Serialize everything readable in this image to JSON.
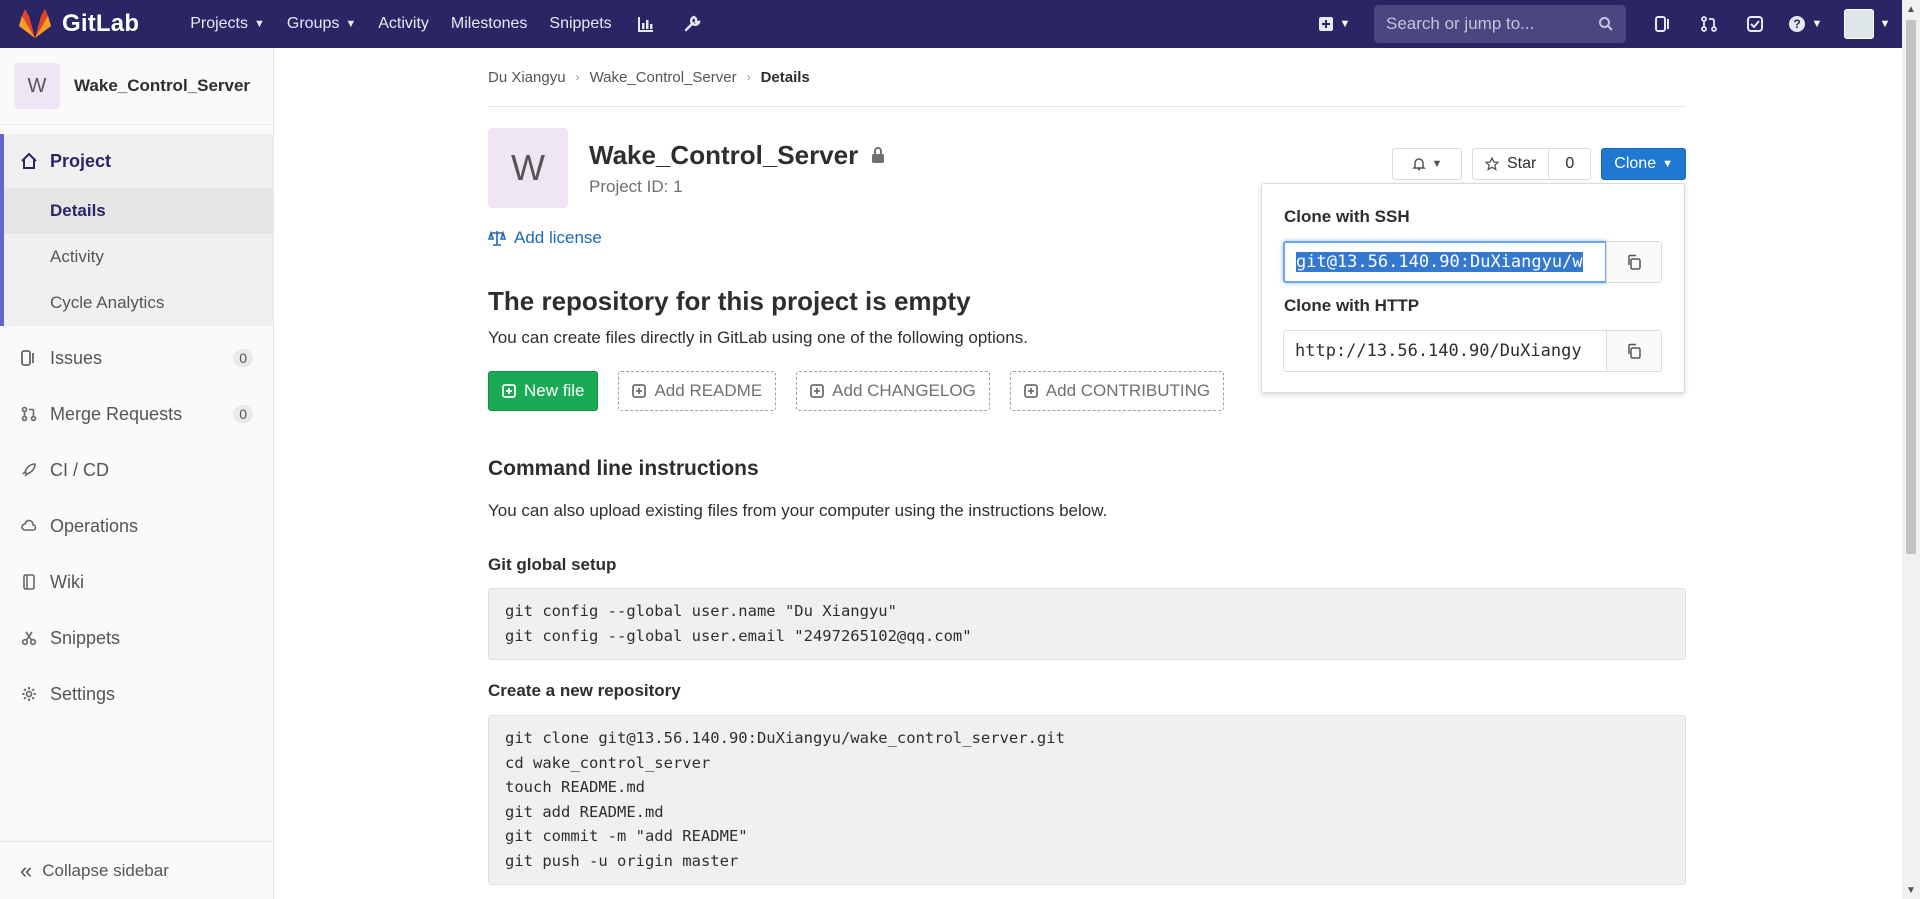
{
  "app": {
    "name": "GitLab"
  },
  "topnav": {
    "items": [
      {
        "label": "Projects"
      },
      {
        "label": "Groups"
      },
      {
        "label": "Activity"
      },
      {
        "label": "Milestones"
      },
      {
        "label": "Snippets"
      }
    ],
    "search_placeholder": "Search or jump to..."
  },
  "sidebar": {
    "project_initial": "W",
    "project_name": "Wake_Control_Server",
    "project_label": "Project",
    "project_sub": [
      "Details",
      "Activity",
      "Cycle Analytics"
    ],
    "items": [
      {
        "label": "Issues",
        "count": "0"
      },
      {
        "label": "Merge Requests",
        "count": "0"
      },
      {
        "label": "CI / CD"
      },
      {
        "label": "Operations"
      },
      {
        "label": "Wiki"
      },
      {
        "label": "Snippets"
      },
      {
        "label": "Settings"
      }
    ],
    "collapse_label": "Collapse sidebar"
  },
  "breadcrumb": [
    "Du Xiangyu",
    "Wake_Control_Server",
    "Details"
  ],
  "project": {
    "initial": "W",
    "title": "Wake_Control_Server",
    "id_text": "Project ID: 1",
    "add_license": "Add license",
    "star_label": "Star",
    "star_count": "0",
    "clone_label": "Clone"
  },
  "empty": {
    "title": "The repository for this project is empty",
    "desc": "You can create files directly in GitLab using one of the following options.",
    "buttons": [
      "New file",
      "Add README",
      "Add CHANGELOG",
      "Add CONTRIBUTING"
    ]
  },
  "cli": {
    "title": "Command line instructions",
    "desc": "You can also upload existing files from your computer using the instructions below.",
    "global_title": "Git global setup",
    "global_lines": [
      "git config --global user.name \"Du Xiangyu\"",
      "git config --global user.email \"2497265102@qq.com\""
    ],
    "newrepo_title": "Create a new repository",
    "newrepo_lines": [
      "git clone git@13.56.140.90:DuXiangyu/wake_control_server.git",
      "cd wake_control_server",
      "touch README.md",
      "git add README.md",
      "git commit -m \"add README\"",
      "git push -u origin master"
    ]
  },
  "clone_menu": {
    "ssh_label": "Clone with SSH",
    "ssh_value": "git@13.56.140.90:DuXiangyu/w",
    "http_label": "Clone with HTTP",
    "http_value": "http://13.56.140.90/DuXiangy"
  },
  "colors": {
    "nav_bg": "#2a2565",
    "accent": "#1f78d1",
    "green": "#1aaa55"
  }
}
